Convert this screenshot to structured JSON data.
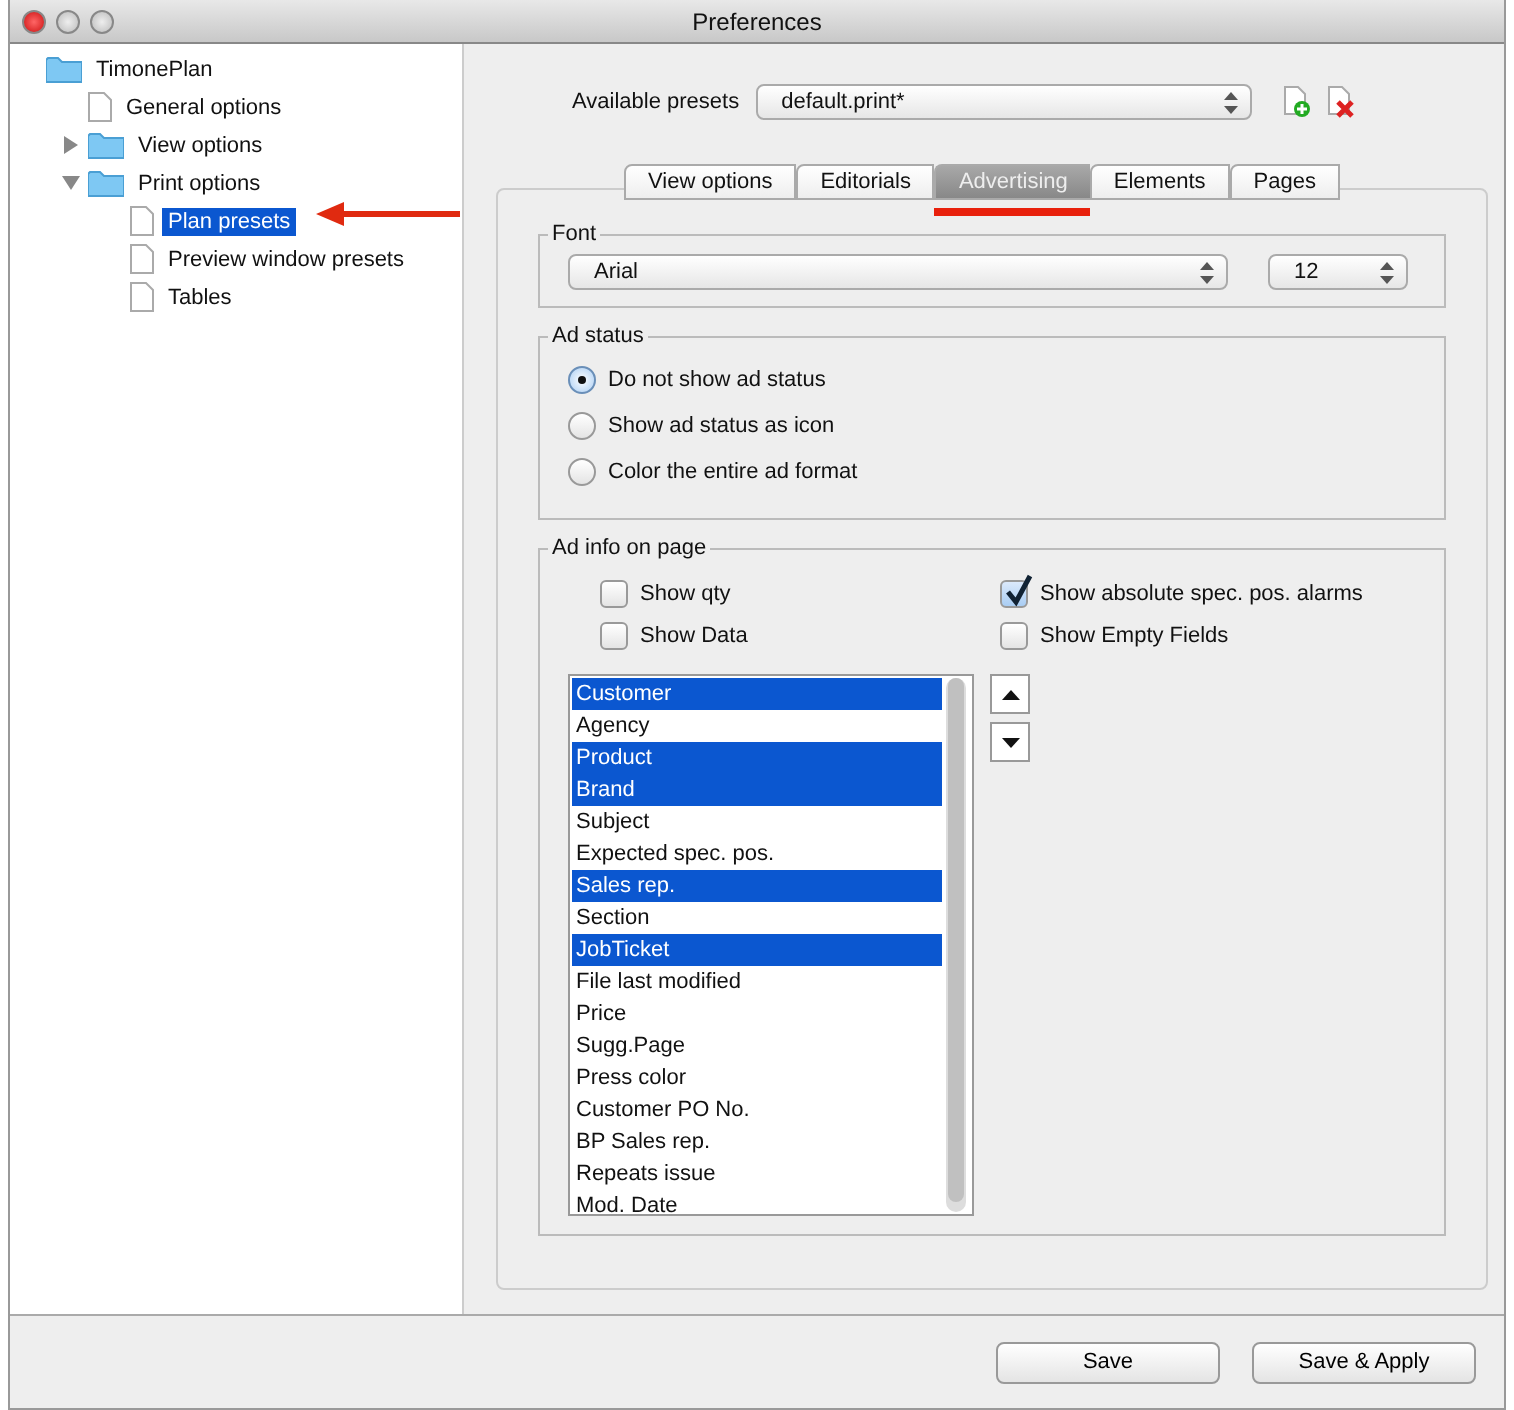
{
  "window": {
    "title": "Preferences"
  },
  "tree": [
    {
      "label": "TimonePlan",
      "kind": "folder",
      "selected": false,
      "children": [
        {
          "label": "General options",
          "kind": "file",
          "selected": false
        },
        {
          "label": "View options",
          "kind": "folder",
          "expanded": false,
          "selected": false
        },
        {
          "label": "Print options",
          "kind": "folder",
          "expanded": true,
          "selected": false,
          "children": [
            {
              "label": "Plan presets",
              "kind": "file",
              "selected": true
            },
            {
              "label": "Preview window presets",
              "kind": "file",
              "selected": false
            },
            {
              "label": "Tables",
              "kind": "file",
              "selected": false
            }
          ]
        }
      ]
    }
  ],
  "presets": {
    "label": "Available presets",
    "value": "default.print*"
  },
  "tabs": [
    {
      "label": "View options",
      "selected": false
    },
    {
      "label": "Editorials",
      "selected": false
    },
    {
      "label": "Advertising",
      "selected": true
    },
    {
      "label": "Elements",
      "selected": false
    },
    {
      "label": "Pages",
      "selected": false
    }
  ],
  "font": {
    "legend": "Font",
    "family": "Arial",
    "size": "12"
  },
  "ad_status": {
    "legend": "Ad status",
    "options": [
      {
        "label": "Do not show ad status",
        "selected": true
      },
      {
        "label": "Show ad status as icon",
        "selected": false
      },
      {
        "label": "Color the entire ad format",
        "selected": false
      }
    ]
  },
  "ad_info": {
    "legend": "Ad info on page",
    "checkboxes": [
      {
        "label": "Show qty",
        "checked": false
      },
      {
        "label": "Show absolute spec. pos. alarms",
        "checked": true
      },
      {
        "label": "Show Data",
        "checked": false
      },
      {
        "label": "Show Empty Fields",
        "checked": false
      }
    ],
    "fields": [
      {
        "label": "Customer",
        "selected": true
      },
      {
        "label": "Agency",
        "selected": false
      },
      {
        "label": "Product",
        "selected": true
      },
      {
        "label": "Brand",
        "selected": true
      },
      {
        "label": "Subject",
        "selected": false
      },
      {
        "label": "Expected spec. pos.",
        "selected": false
      },
      {
        "label": "Sales rep.",
        "selected": true
      },
      {
        "label": "Section",
        "selected": false
      },
      {
        "label": "JobTicket",
        "selected": true
      },
      {
        "label": "File last modified",
        "selected": false
      },
      {
        "label": "Price",
        "selected": false
      },
      {
        "label": "Sugg.Page",
        "selected": false
      },
      {
        "label": "Press color",
        "selected": false
      },
      {
        "label": "Customer PO No.",
        "selected": false
      },
      {
        "label": "BP Sales rep.",
        "selected": false
      },
      {
        "label": "Repeats issue",
        "selected": false
      },
      {
        "label": "Mod. Date",
        "selected": false
      }
    ]
  },
  "buttons": [
    "Save",
    "Save & Apply"
  ]
}
